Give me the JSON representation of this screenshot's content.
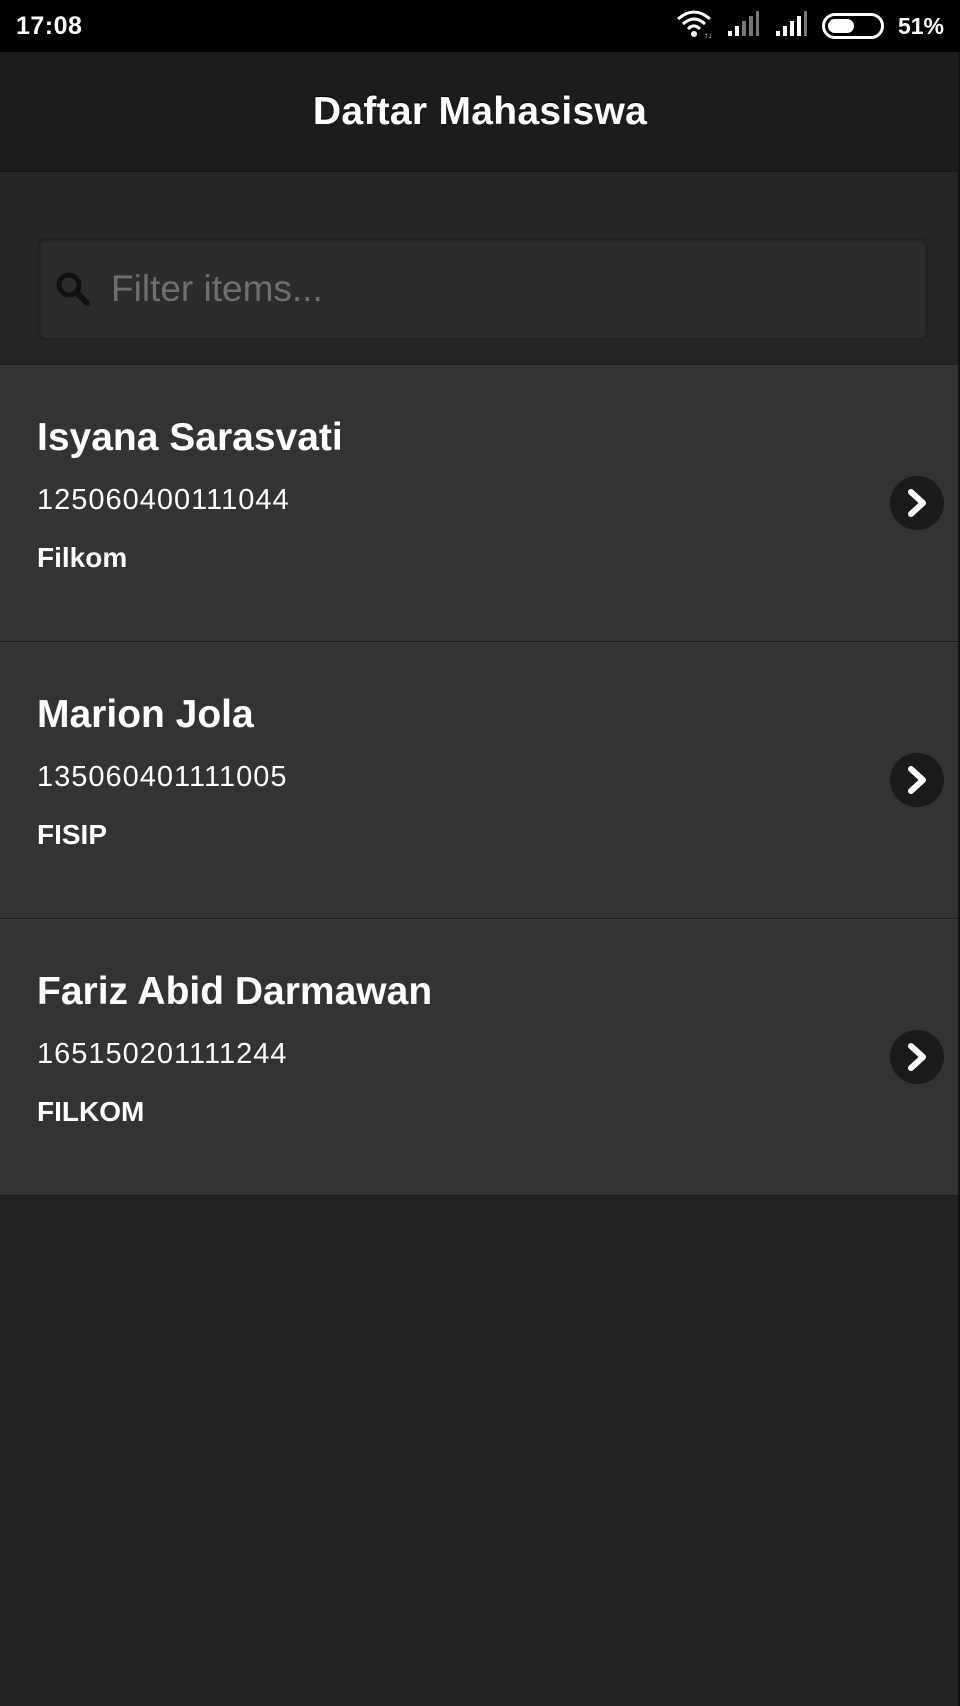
{
  "status_bar": {
    "time": "17:08",
    "battery_percent_label": "51%",
    "battery_level": 0.51,
    "icons": [
      "wifi-icon",
      "signal-icon",
      "signal-icon",
      "battery-icon"
    ]
  },
  "header": {
    "title": "Daftar Mahasiswa"
  },
  "search": {
    "placeholder": "Filter items...",
    "value": ""
  },
  "students": [
    {
      "name": "Isyana Sarasvati",
      "nim": "125060400111044",
      "faculty": "Filkom"
    },
    {
      "name": "Marion Jola",
      "nim": "135060401111005",
      "faculty": "FISIP"
    },
    {
      "name": "Fariz Abid Darmawan",
      "nim": "165150201111244",
      "faculty": "FILKOM"
    }
  ],
  "colors": {
    "background": "#222222",
    "header_bg": "#1c1c1c",
    "item_bg": "#333333",
    "text": "#ffffff"
  }
}
